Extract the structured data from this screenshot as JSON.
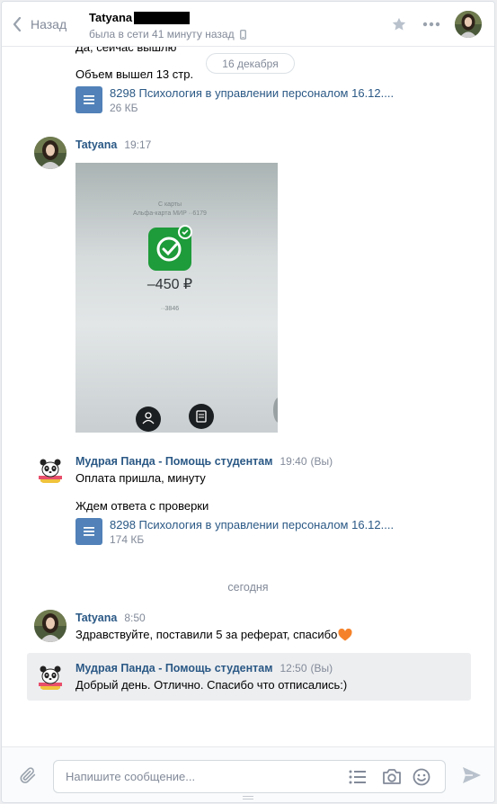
{
  "header": {
    "back_label": "Назад",
    "peer_name": "Tatyana",
    "peer_status": "была в сети 41 минуту назад"
  },
  "history": {
    "top_partial_text": "Да, сейчас вышлю",
    "date_pill": "16 декабря",
    "volume_text": "Объем вышел 13 стр.",
    "doc1": {
      "title": "8298 Психология в управлении персоналом 16.12....",
      "size": "26 КБ"
    },
    "msg_photo": {
      "author": "Tatyana",
      "time": "19:17"
    },
    "photo": {
      "from_card": "С карты",
      "card_name": "Альфа-карта МИР ··6179",
      "amount": "–450 ₽",
      "account": "··3846"
    },
    "msg_panda1": {
      "author": "Мудрая Панда - Помощь студентам",
      "time": "19:40",
      "via": "(Вы)",
      "text1": "Оплата пришла, минуту",
      "text2": "Ждем ответа с проверки"
    },
    "doc2": {
      "title": "8298 Психология в управлении персоналом 16.12....",
      "size": "174 КБ"
    },
    "day_separator": "сегодня",
    "msg_tatyana2": {
      "author": "Tatyana",
      "time": "8:50",
      "text": "Здравствуйте, поставили 5 за реферат, спасибо"
    },
    "msg_panda2": {
      "author": "Мудрая Панда - Помощь студентам",
      "time": "12:50",
      "via": "(Вы)",
      "text": "Добрый день. Отлично. Спасибо что отписались:)"
    }
  },
  "composer": {
    "placeholder": "Напишите сообщение..."
  },
  "colors": {
    "link": "#2a5885",
    "muted": "#828a99",
    "doc_icon": "#5181b8",
    "success_green": "#1e9b3a"
  }
}
